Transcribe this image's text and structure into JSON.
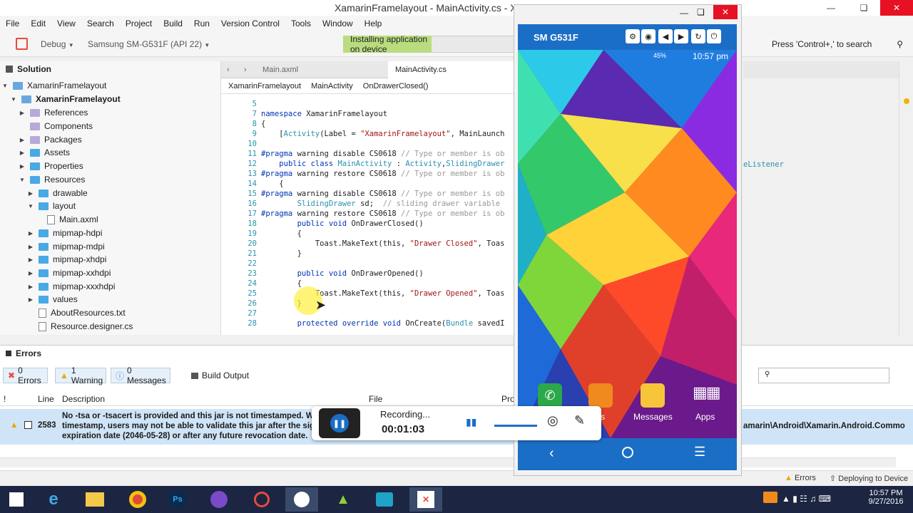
{
  "window": {
    "title": "XamarinFramelayout - MainActivity.cs - Xamarin Studio"
  },
  "menu": [
    "File",
    "Edit",
    "View",
    "Search",
    "Project",
    "Build",
    "Run",
    "Version Control",
    "Tools",
    "Window",
    "Help"
  ],
  "toolbar": {
    "config": "Debug",
    "device": "Samsung SM-G531F (API 22)",
    "status": "Installing application on device",
    "search_placeholder": "Press 'Control+,' to search"
  },
  "solution": {
    "title": "Solution",
    "items": [
      "XamarinFramelayout",
      "XamarinFramelayout",
      "References",
      "Components",
      "Packages",
      "Assets",
      "Properties",
      "Resources",
      "drawable",
      "layout",
      "Main.axml",
      "mipmap-hdpi",
      "mipmap-mdpi",
      "mipmap-xhdpi",
      "mipmap-xxhdpi",
      "mipmap-xxxhdpi",
      "values",
      "AboutResources.txt",
      "Resource.designer.cs"
    ]
  },
  "editor": {
    "tabs": [
      "Main.axml",
      "MainActivity.cs"
    ],
    "breadcrumbs": [
      "XamarinFramelayout",
      "MainActivity",
      "OnDrawerClosed()"
    ],
    "lines": [
      {
        "n": "5",
        "t": ""
      },
      {
        "n": "7",
        "t": "namespace XamarinFramelayout"
      },
      {
        "n": "8",
        "t": "{"
      },
      {
        "n": "9",
        "t": "    [Activity(Label = \"XamarinFramelayout\", MainLaunch"
      },
      {
        "n": "10",
        "t": ""
      },
      {
        "n": "11",
        "t": "#pragma warning disable CS0618 // Type or member is ob"
      },
      {
        "n": "12",
        "t": "    public class MainActivity : Activity,SlidingDrawer"
      },
      {
        "n": "13",
        "t": "#pragma warning restore CS0618 // Type or member is ob"
      },
      {
        "n": "14",
        "t": "    {"
      },
      {
        "n": "15",
        "t": "#pragma warning disable CS0618 // Type or member is ob"
      },
      {
        "n": "16",
        "t": "        SlidingDrawer sd;  // sliding drawer variable"
      },
      {
        "n": "17",
        "t": "#pragma warning restore CS0618 // Type or member is ob"
      },
      {
        "n": "18",
        "t": "        public void OnDrawerClosed()"
      },
      {
        "n": "19",
        "t": "        {"
      },
      {
        "n": "20",
        "t": "            Toast.MakeText(this, \"Drawer Closed\", Toas"
      },
      {
        "n": "21",
        "t": "        }"
      },
      {
        "n": "22",
        "t": ""
      },
      {
        "n": "23",
        "t": "        public void OnDrawerOpened()"
      },
      {
        "n": "24",
        "t": "        {"
      },
      {
        "n": "25",
        "t": "            Toast.MakeText(this, \"Drawer Opened\", Toas"
      },
      {
        "n": "26",
        "t": "        }"
      },
      {
        "n": "27",
        "t": ""
      },
      {
        "n": "28",
        "t": "        protected override void OnCreate(Bundle savedI"
      }
    ],
    "overflow_text": "eListener"
  },
  "errors": {
    "title": "Errors",
    "filters": [
      "0 Errors",
      "1 Warning",
      "0 Messages"
    ],
    "build_output": "Build Output",
    "columns": [
      "!",
      "Line",
      "Description",
      "File",
      "Pro"
    ],
    "row": {
      "line": "2583",
      "desc1": "No -tsa or -tsacert is provided and this jar is not timestamped. With",
      "desc2": "timestamp, users may not be able to validate this jar after the signe",
      "desc3": "expiration date (2046-05-28) or after any future revocation date.",
      "path": "amarin\\Android\\Xamarin.Android.Commo"
    }
  },
  "statusbar": {
    "errors": "Errors",
    "deploying": "Deploying to Device"
  },
  "emulator": {
    "device_name": "SM G531F",
    "status_battery": "45%",
    "status_time": "10:57 pm",
    "dock": [
      "acts",
      "Messages",
      "Apps"
    ]
  },
  "recorder": {
    "label": "Recording...",
    "time": "00:01:03"
  },
  "taskbar": {
    "time": "10:57 PM",
    "date": "9/27/2016"
  },
  "colors": {
    "accent": "#1b6ec6",
    "status_green": "#b9dc7f",
    "row_highlight": "#cfe4f7",
    "taskbar": "#1c2541"
  }
}
